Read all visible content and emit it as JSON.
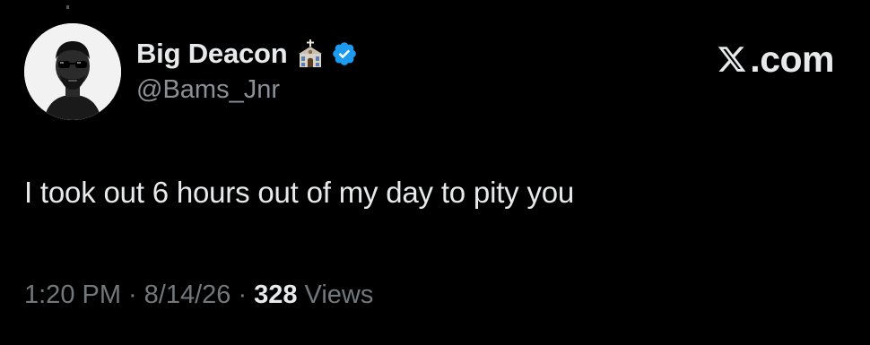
{
  "tweet": {
    "author": {
      "display_name": "Big Deacon",
      "handle": "@Bams_Jnr",
      "badge_icon": "church-icon",
      "verified_icon": "verified-badge-icon",
      "verified_color": "#1d9bf0"
    },
    "brand": {
      "logo_icon": "x-logo-icon",
      "label": ".com"
    },
    "text": "I took out 6 hours out of my day to pity you",
    "meta": {
      "time": "1:20 PM",
      "separator": "·",
      "date": "8/14/26",
      "views_count": "328",
      "views_label": "Views"
    }
  },
  "colors": {
    "background": "#000000",
    "primary_text": "#e7e9ea",
    "secondary_text": "#73787d",
    "verified": "#1d9bf0"
  }
}
